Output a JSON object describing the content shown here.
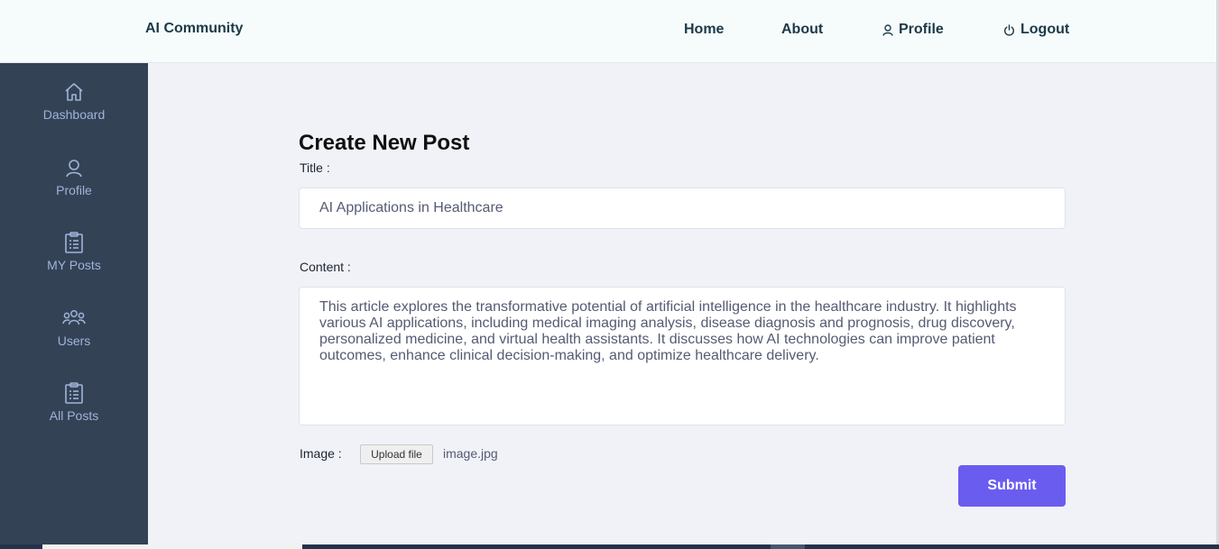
{
  "brand": "AI Community",
  "nav": {
    "home": "Home",
    "about": "About",
    "profile": "Profile",
    "logout": "Logout",
    "profile_icon": "user-icon",
    "logout_icon": "power-icon"
  },
  "sidebar": {
    "items": [
      {
        "label": "Dashboard",
        "icon": "home-icon"
      },
      {
        "label": "Profile",
        "icon": "user-icon"
      },
      {
        "label": "MY Posts",
        "icon": "clipboard-icon"
      },
      {
        "label": "Users",
        "icon": "users-icon"
      },
      {
        "label": "All Posts",
        "icon": "clipboard-icon"
      }
    ]
  },
  "form": {
    "heading": "Create New Post",
    "title_label": "Title :",
    "title_value": "AI Applications in Healthcare",
    "content_label": "Content :",
    "content_value": "This article explores the transformative potential of artificial intelligence in the healthcare industry. It highlights various AI applications, including medical imaging analysis, disease diagnosis and prognosis, drug discovery, personalized medicine, and virtual health assistants. It discusses how AI technologies can improve patient outcomes, enhance clinical decision-making, and optimize healthcare delivery.",
    "image_label": "Image :",
    "upload_label": "Upload file",
    "file_name": "image.jpg",
    "submit_label": "Submit"
  },
  "colors": {
    "sidebar_bg": "#344256",
    "sidebar_text": "#9fb4d8",
    "submit_bg": "#6b5cf0",
    "nav_text": "#1c3a47"
  }
}
